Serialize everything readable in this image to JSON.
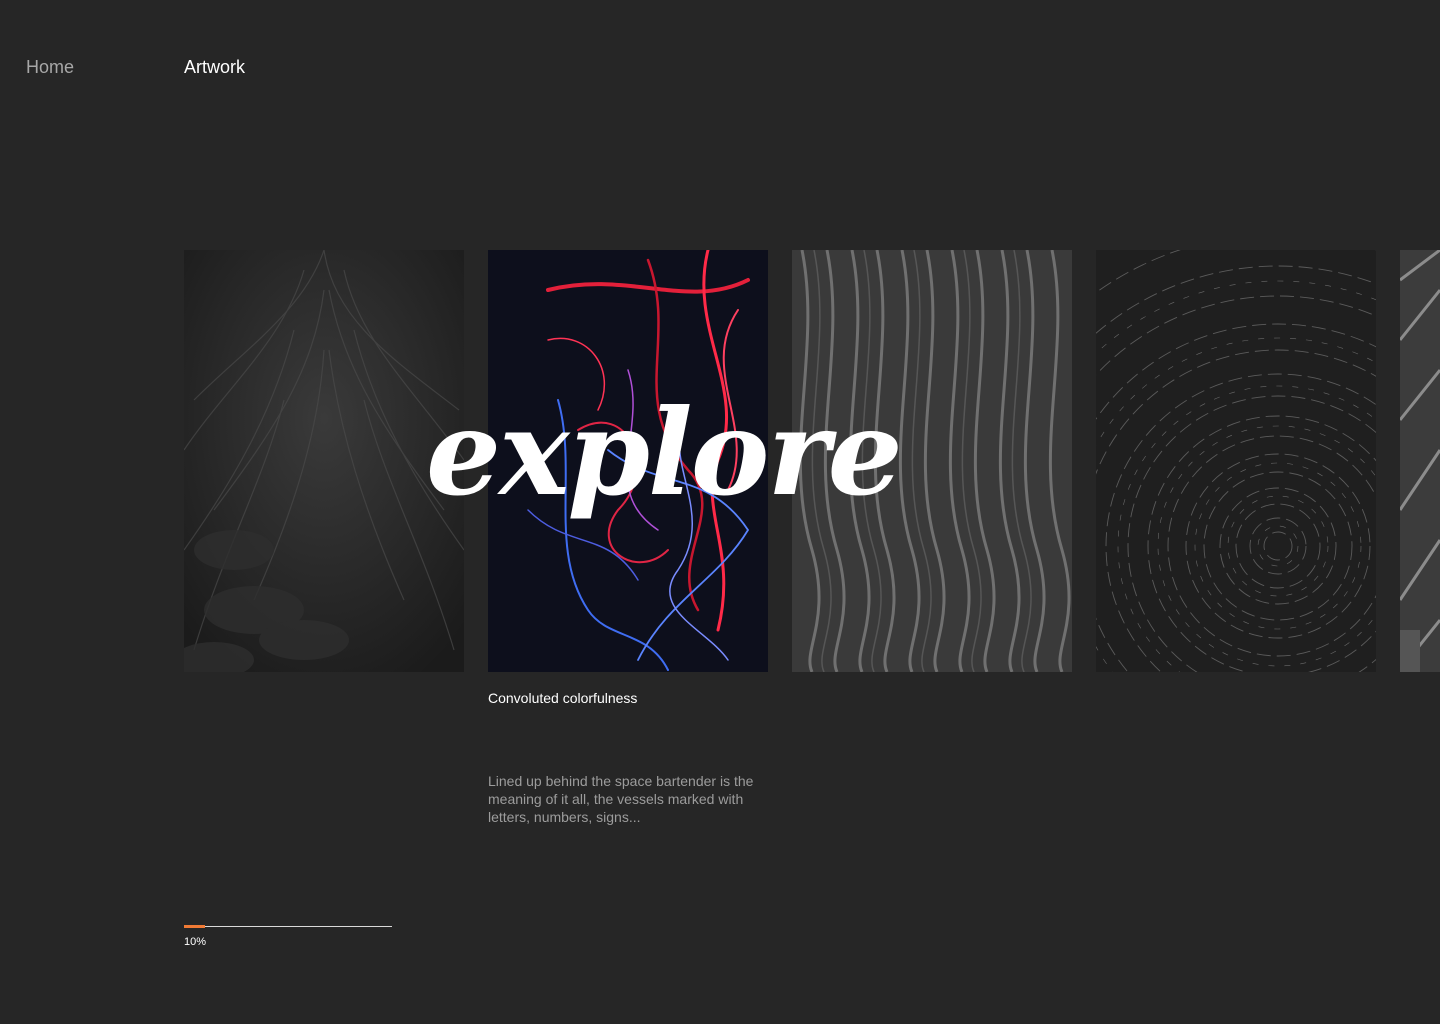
{
  "nav": {
    "home_label": "Home",
    "artwork_label": "Artwork"
  },
  "hero": {
    "word": "explore"
  },
  "gallery": {
    "items": [
      {
        "name": "dark-feather-texture"
      },
      {
        "name": "red-blue-light-trails"
      },
      {
        "name": "wavy-lines-texture"
      },
      {
        "name": "star-trails-spiral"
      },
      {
        "name": "partial-gray-artwork"
      }
    ],
    "active": {
      "title": "Convoluted colorfulness",
      "description": "Lined up behind the space bartender is the meaning of it all, the vessels marked with letters, numbers, signs..."
    }
  },
  "progress": {
    "value": 0.1,
    "label": "10%"
  },
  "colors": {
    "background": "#262626",
    "accent": "#f07a35",
    "text_primary": "#ffffff",
    "text_muted": "#9c9c9c"
  }
}
